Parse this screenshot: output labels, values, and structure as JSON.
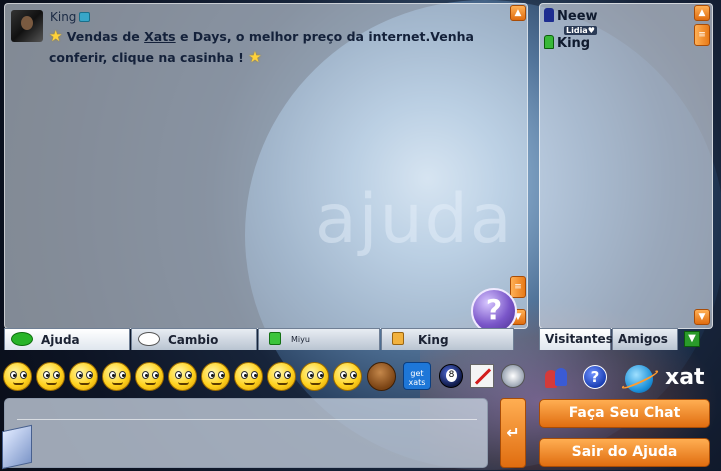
{
  "background": {
    "watermark": "ajuda"
  },
  "chat": {
    "message": {
      "username": "King",
      "text_before": " Vendas de ",
      "link": "Xats",
      "text_after": " e Days, o melhor preço da internet.Venha conferir, clique na casinha ! "
    },
    "help_icon": "?"
  },
  "tabs": [
    {
      "label": "Ajuda",
      "icon": "green-chat-bubble-icon"
    },
    {
      "label": "Cambio",
      "icon": "white-chat-bubble-icon"
    },
    {
      "label": "Miyu",
      "icon": "green-lock-icon"
    },
    {
      "label": "King",
      "icon": "orange-lock-icon"
    }
  ],
  "users": {
    "list": [
      {
        "name": "Neew",
        "sub": "Lidia♥",
        "icon": "blue-user-icon"
      },
      {
        "name": "King",
        "icon": "green-user-icon"
      }
    ],
    "tabs": [
      "Visitantes",
      "Amigos"
    ]
  },
  "toolbar": {
    "getxats_label": "get xats",
    "help_label": "?",
    "logo_text": "xat"
  },
  "input": {
    "value": "",
    "placeholder": ""
  },
  "buttons": {
    "send": "↵",
    "create_chat": "Faça Seu Chat",
    "leave": "Sair do Ajuda"
  },
  "colors": {
    "accent": "#e87a18",
    "panel": "#e6eef8"
  }
}
